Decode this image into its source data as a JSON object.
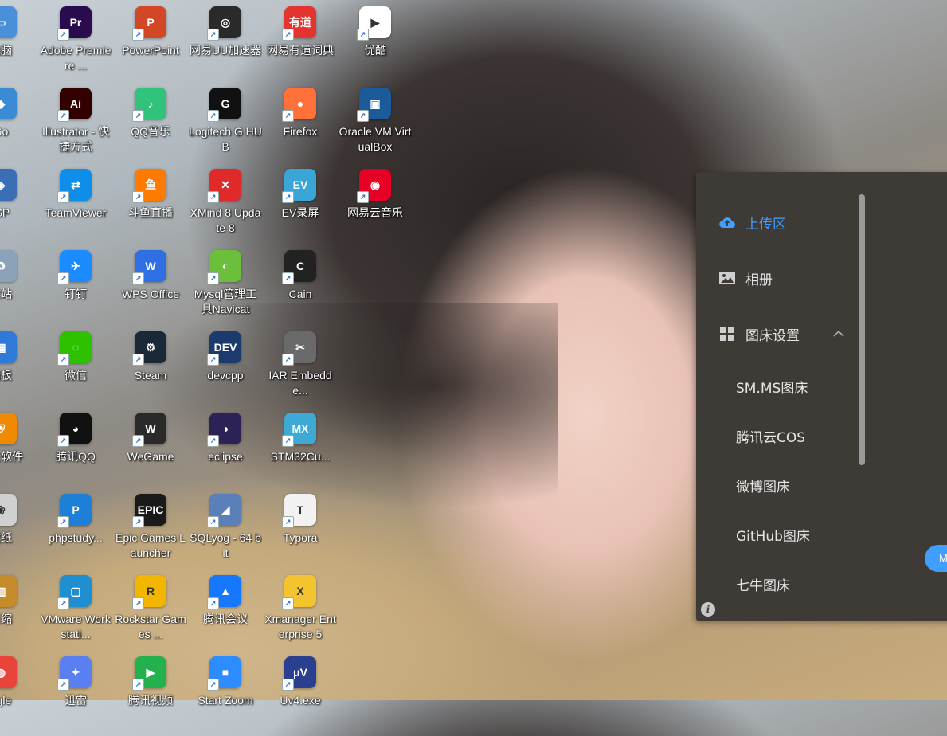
{
  "desktop": {
    "icons": [
      {
        "label": "电脑",
        "icon": "computer-icon",
        "color": "#4a90d9",
        "glyph": "▭"
      },
      {
        "label": "Adobe Premiere ...",
        "icon": "premiere-icon",
        "color": "#2a0c4e",
        "glyph": "Pr"
      },
      {
        "label": "PowerPoint",
        "icon": "powerpoint-icon",
        "color": "#d24726",
        "glyph": "P"
      },
      {
        "label": "网易UU加速器",
        "icon": "uu-accelerator-icon",
        "color": "#2a2a2a",
        "glyph": "◎"
      },
      {
        "label": "网易有道词典",
        "icon": "youdao-icon",
        "color": "#e3342f",
        "glyph": "有道"
      },
      {
        "label": "优酷",
        "icon": "youku-icon",
        "color": "#ffffff",
        "glyph": "▶"
      },
      {
        "label": "Go",
        "icon": "go-icon",
        "color": "#3a8ad6",
        "glyph": "◆"
      },
      {
        "label": "Illustrator - 快捷方式",
        "icon": "illustrator-icon",
        "color": "#330000",
        "glyph": "Ai"
      },
      {
        "label": "QQ音乐",
        "icon": "qqmusic-icon",
        "color": "#31c27c",
        "glyph": "♪"
      },
      {
        "label": "Logitech G HUB",
        "icon": "logitech-icon",
        "color": "#111111",
        "glyph": "G"
      },
      {
        "label": "Firefox",
        "icon": "firefox-icon",
        "color": "#ff7139",
        "glyph": "●"
      },
      {
        "label": "Oracle VM VirtualBox",
        "icon": "virtualbox-icon",
        "color": "#1c5b9a",
        "glyph": "▣"
      },
      {
        "label": "ISP",
        "icon": "isp-icon",
        "color": "#3a6fb5",
        "glyph": "◈"
      },
      {
        "label": "TeamViewer",
        "icon": "teamviewer-icon",
        "color": "#0e8ee9",
        "glyph": "⇄"
      },
      {
        "label": "斗鱼直播",
        "icon": "douyu-icon",
        "color": "#ff7a00",
        "glyph": "鱼"
      },
      {
        "label": "XMind 8 Update 8",
        "icon": "xmind-icon",
        "color": "#e02a2a",
        "glyph": "✕"
      },
      {
        "label": "EV录屏",
        "icon": "ev-recorder-icon",
        "color": "#3aa6d8",
        "glyph": "EV"
      },
      {
        "label": "网易云音乐",
        "icon": "netease-music-icon",
        "color": "#e60026",
        "glyph": "◉"
      },
      {
        "label": "收站",
        "icon": "recycle-bin-icon",
        "color": "#8aa3b8",
        "glyph": "♻"
      },
      {
        "label": "钉钉",
        "icon": "dingtalk-icon",
        "color": "#1b8cff",
        "glyph": "✈"
      },
      {
        "label": "WPS Office",
        "icon": "wps-icon",
        "color": "#2f6fe4",
        "glyph": "W"
      },
      {
        "label": "Mysql管理工具Navicat",
        "icon": "navicat-icon",
        "color": "#6bbf3a",
        "glyph": "◐"
      },
      {
        "label": "Cain",
        "icon": "cain-icon",
        "color": "#222222",
        "glyph": "C"
      },
      {
        "label": "",
        "icon": "",
        "color": "",
        "glyph": ""
      },
      {
        "label": "面板",
        "icon": "control-panel-icon",
        "color": "#2f7ad6",
        "glyph": "▦"
      },
      {
        "label": "微信",
        "icon": "wechat-icon",
        "color": "#2dc100",
        "glyph": "◌"
      },
      {
        "label": "Steam",
        "icon": "steam-icon",
        "color": "#1b2838",
        "glyph": "⚙"
      },
      {
        "label": "devcpp",
        "icon": "devcpp-icon",
        "color": "#1d3a6e",
        "glyph": "DEV"
      },
      {
        "label": "IAR Embedde...",
        "icon": "iar-icon",
        "color": "#6a6a6a",
        "glyph": "✂"
      },
      {
        "label": "",
        "icon": "",
        "color": "",
        "glyph": ""
      },
      {
        "label": "安全软件",
        "icon": "security-icon",
        "color": "#f08a00",
        "glyph": "⛨"
      },
      {
        "label": "腾讯QQ",
        "icon": "qq-icon",
        "color": "#111111",
        "glyph": "◕"
      },
      {
        "label": "WeGame",
        "icon": "wegame-icon",
        "color": "#2a2a2a",
        "glyph": "W"
      },
      {
        "label": "eclipse",
        "icon": "eclipse-icon",
        "color": "#2c2255",
        "glyph": "◑"
      },
      {
        "label": "STM32Cu...",
        "icon": "stm32-icon",
        "color": "#3fa9d6",
        "glyph": "MX"
      },
      {
        "label": "",
        "icon": "",
        "color": "",
        "glyph": ""
      },
      {
        "label": "壁纸",
        "icon": "wallpaper-icon",
        "color": "#d0d0d0",
        "glyph": "❀"
      },
      {
        "label": "phpstudy...",
        "icon": "phpstudy-icon",
        "color": "#1e7fd6",
        "glyph": "P"
      },
      {
        "label": "Epic Games Launcher",
        "icon": "epic-icon",
        "color": "#1a1a1a",
        "glyph": "EPIC"
      },
      {
        "label": "SQLyog - 64 bit",
        "icon": "sqlyog-icon",
        "color": "#5b7fb8",
        "glyph": "◢"
      },
      {
        "label": "Typora",
        "icon": "typora-icon",
        "color": "#f2f2f2",
        "glyph": "T"
      },
      {
        "label": "",
        "icon": "",
        "color": "",
        "glyph": ""
      },
      {
        "label": "压缩",
        "icon": "archive-icon",
        "color": "#c58a2a",
        "glyph": "▥"
      },
      {
        "label": "VMware Workstati...",
        "icon": "vmware-icon",
        "color": "#1f8fd1",
        "glyph": "▢"
      },
      {
        "label": "Rockstar Games ...",
        "icon": "rockstar-icon",
        "color": "#f2b600",
        "glyph": "R"
      },
      {
        "label": "腾讯会议",
        "icon": "tencent-meeting-icon",
        "color": "#1677ff",
        "glyph": "▲"
      },
      {
        "label": "Xmanager Enterprise 5",
        "icon": "xmanager-icon",
        "color": "#f4c430",
        "glyph": "X"
      },
      {
        "label": "",
        "icon": "",
        "color": "",
        "glyph": ""
      },
      {
        "label": "ogle",
        "icon": "chrome-icon",
        "color": "#e8443a",
        "glyph": "◍"
      },
      {
        "label": "迅雷",
        "icon": "thunder-icon",
        "color": "#5a7ff0",
        "glyph": "✦"
      },
      {
        "label": "腾讯视频",
        "icon": "tencent-video-icon",
        "color": "#22b14c",
        "glyph": "▶"
      },
      {
        "label": "Start Zoom",
        "icon": "zoom-icon",
        "color": "#2d8cff",
        "glyph": "■"
      },
      {
        "label": "Uv4.exe",
        "icon": "uv4-icon",
        "color": "#2a3f8f",
        "glyph": "μV"
      },
      {
        "label": "",
        "icon": "",
        "color": "",
        "glyph": ""
      }
    ]
  },
  "panel": {
    "menu": {
      "upload": {
        "label": "上传区"
      },
      "album": {
        "label": "相册"
      },
      "settings": {
        "label": "图床设置"
      }
    },
    "submenu": [
      {
        "label": "SM.MS图床"
      },
      {
        "label": "腾讯云COS"
      },
      {
        "label": "微博图床"
      },
      {
        "label": "GitHub图床"
      },
      {
        "label": "七牛图床"
      }
    ],
    "info_glyph": "i",
    "pill_text": "M",
    "accent": "#409eff"
  }
}
